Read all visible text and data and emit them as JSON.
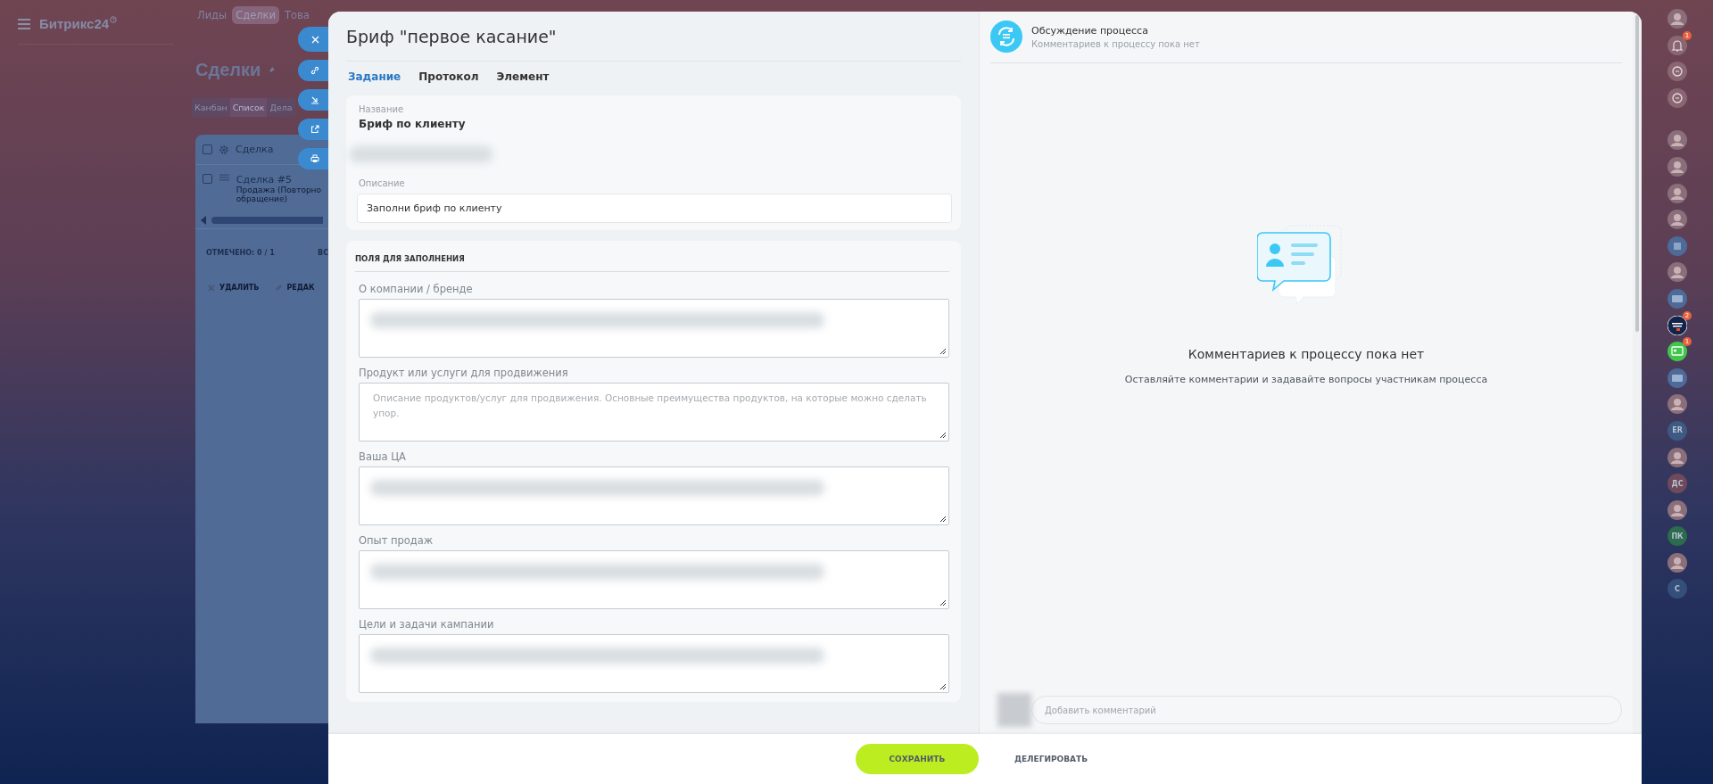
{
  "background_app": {
    "logo": "Битрикс24",
    "nav": [
      {
        "label": "Лиды",
        "selected": false
      },
      {
        "label": "Сделки",
        "selected": true
      },
      {
        "label": "Това",
        "selected": false
      }
    ],
    "page_title": "Сделки",
    "view_tabs": [
      {
        "label": "Канбан",
        "selected": false
      },
      {
        "label": "Список",
        "selected": true
      },
      {
        "label": "Дела",
        "selected": false
      }
    ],
    "table": {
      "header": "Сделка",
      "header_checked": false,
      "rows": [
        {
          "checked": false,
          "title": "Сделка #5",
          "subtitle": [
            "Продажа (Повторно",
            "обращение)"
          ]
        }
      ],
      "selected_count": "ОТМЕЧЕНО: 0 / 1",
      "total": "ВС",
      "actions": [
        "УДАЛИТЬ",
        "РЕДАК"
      ]
    }
  },
  "task": {
    "title": "Бриф \"первое касание\"",
    "tabs": [
      {
        "label": "Задание",
        "selected": true
      },
      {
        "label": "Протокол",
        "selected": false
      },
      {
        "label": "Элемент",
        "selected": false
      }
    ],
    "name_label": "Название",
    "name_value": "Бриф по клиенту",
    "description_label": "Описание",
    "description_value": "Заполни бриф по клиенту",
    "fields_heading": "ПОЛЯ ДЛЯ ЗАПОЛНЕНИЯ",
    "fields": [
      {
        "label": "О компании / бренде",
        "kind": "blurred"
      },
      {
        "label": "Продукт или услуги для продвижения",
        "kind": "empty",
        "placeholder": "Описание продуктов/услуг для продвижения. Основные преимущества продуктов, на которые можно сделать упор."
      },
      {
        "label": "Ваша ЦА",
        "kind": "blurred"
      },
      {
        "label": "Опыт продаж",
        "kind": "blurred"
      },
      {
        "label": "Цели и задачи кампании",
        "kind": "blurred"
      }
    ]
  },
  "discussion": {
    "title": "Обсуждение процесса",
    "subtitle": "Комментариев к процессу пока нет",
    "empty_title": "Комментариев к процессу пока нет",
    "empty_text": "Оставляйте комментарии и задавайте вопросы участникам процесса",
    "comment_placeholder": "Добавить комментарий"
  },
  "footer": {
    "buttons": [
      {
        "label": "СОХРАНИТЬ",
        "kind": "primary"
      },
      {
        "label": "ДЕЛЕГИРОВАТЬ",
        "kind": "link"
      }
    ]
  },
  "right_bar": {
    "items": [
      {
        "kind": "photo"
      },
      {
        "kind": "bell",
        "badge": "1"
      },
      {
        "kind": "icon"
      },
      {
        "kind": "icon"
      },
      {
        "kind": "photo"
      },
      {
        "kind": "photo"
      },
      {
        "kind": "photo"
      },
      {
        "kind": "photo"
      },
      {
        "kind": "tile"
      },
      {
        "kind": "photo"
      },
      {
        "kind": "chat"
      },
      {
        "kind": "robot",
        "badge": "2"
      },
      {
        "kind": "chat-green",
        "badge": "1"
      },
      {
        "kind": "chat"
      },
      {
        "kind": "photo"
      },
      {
        "kind": "initials",
        "text": "ER",
        "color": "#3d5a82"
      },
      {
        "kind": "photo"
      },
      {
        "kind": "initials",
        "text": "ДС",
        "color": "#6e4a5c"
      },
      {
        "kind": "photo"
      },
      {
        "kind": "initials",
        "text": "ПК",
        "color": "#2c6b4e"
      },
      {
        "kind": "photo"
      },
      {
        "kind": "initials",
        "text": "С",
        "color": "#34507a"
      }
    ]
  }
}
